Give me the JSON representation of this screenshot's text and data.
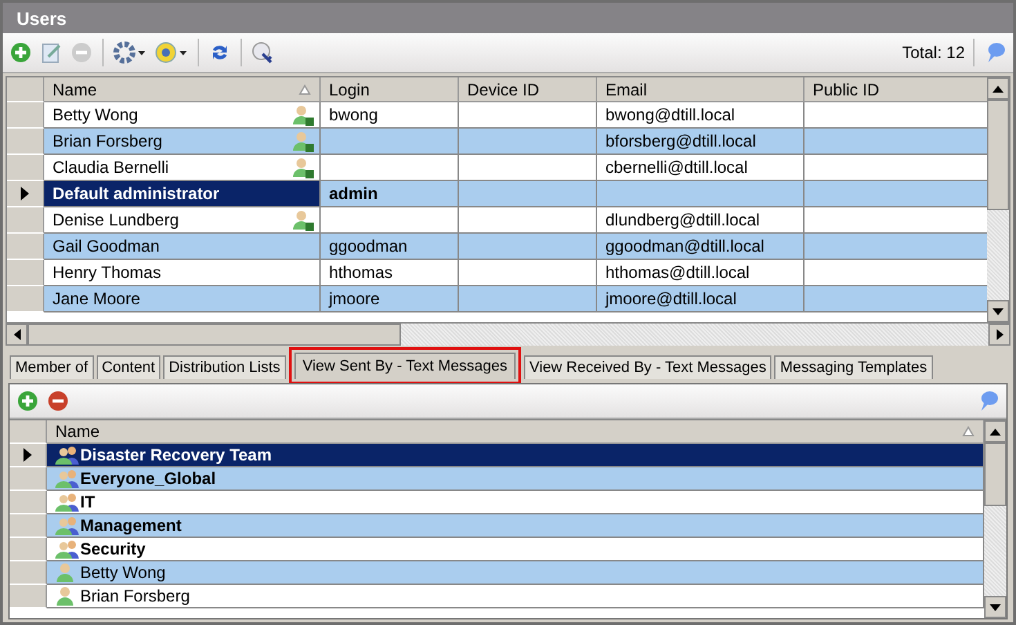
{
  "window": {
    "title": "Users"
  },
  "toolbar": {
    "total": "Total: 12"
  },
  "users": {
    "columns": [
      {
        "label": "Name",
        "sorted": true
      },
      {
        "label": "Login",
        "sorted": false
      },
      {
        "label": "Device ID",
        "sorted": false
      },
      {
        "label": "Email",
        "sorted": false
      },
      {
        "label": "Public ID",
        "sorted": false
      }
    ],
    "rows": [
      {
        "name": "Betty Wong",
        "user_icon": true,
        "login": "bwong",
        "email": "bwong@dtill.local",
        "selected": false
      },
      {
        "name": "Brian Forsberg",
        "user_icon": true,
        "login": "",
        "email": "bforsberg@dtill.local",
        "selected": false
      },
      {
        "name": "Claudia Bernelli",
        "user_icon": true,
        "login": "",
        "email": "cbernelli@dtill.local",
        "selected": false
      },
      {
        "name": "Default administrator",
        "user_icon": false,
        "login": "admin",
        "email": "",
        "selected": true
      },
      {
        "name": "Denise Lundberg",
        "user_icon": true,
        "login": "",
        "email": "dlundberg@dtill.local",
        "selected": false
      },
      {
        "name": "Gail Goodman",
        "user_icon": false,
        "login": "ggoodman",
        "email": "ggoodman@dtill.local",
        "selected": false
      },
      {
        "name": "Henry Thomas",
        "user_icon": false,
        "login": "hthomas",
        "email": "hthomas@dtill.local",
        "selected": false
      },
      {
        "name": "Jane Moore",
        "user_icon": false,
        "login": "jmoore",
        "email": "jmoore@dtill.local",
        "selected": false
      }
    ]
  },
  "tabs": [
    {
      "label": "Member of",
      "selected": false
    },
    {
      "label": "Content",
      "selected": false
    },
    {
      "label": "Distribution Lists",
      "selected": false
    },
    {
      "label": "View Sent By - Text Messages",
      "selected": true
    },
    {
      "label": "View Received By - Text Messages",
      "selected": false
    },
    {
      "label": "Messaging Templates",
      "selected": false
    }
  ],
  "recipients": {
    "column": "Name",
    "rows": [
      {
        "name": "Disaster Recovery Team",
        "kind": "group",
        "selected": true
      },
      {
        "name": "Everyone_Global",
        "kind": "group",
        "selected": false
      },
      {
        "name": "IT",
        "kind": "group",
        "selected": false
      },
      {
        "name": "Management",
        "kind": "group",
        "selected": false
      },
      {
        "name": "Security",
        "kind": "group",
        "selected": false
      },
      {
        "name": "Betty Wong",
        "kind": "user",
        "selected": false
      },
      {
        "name": "Brian Forsberg",
        "kind": "user",
        "selected": false
      }
    ]
  }
}
